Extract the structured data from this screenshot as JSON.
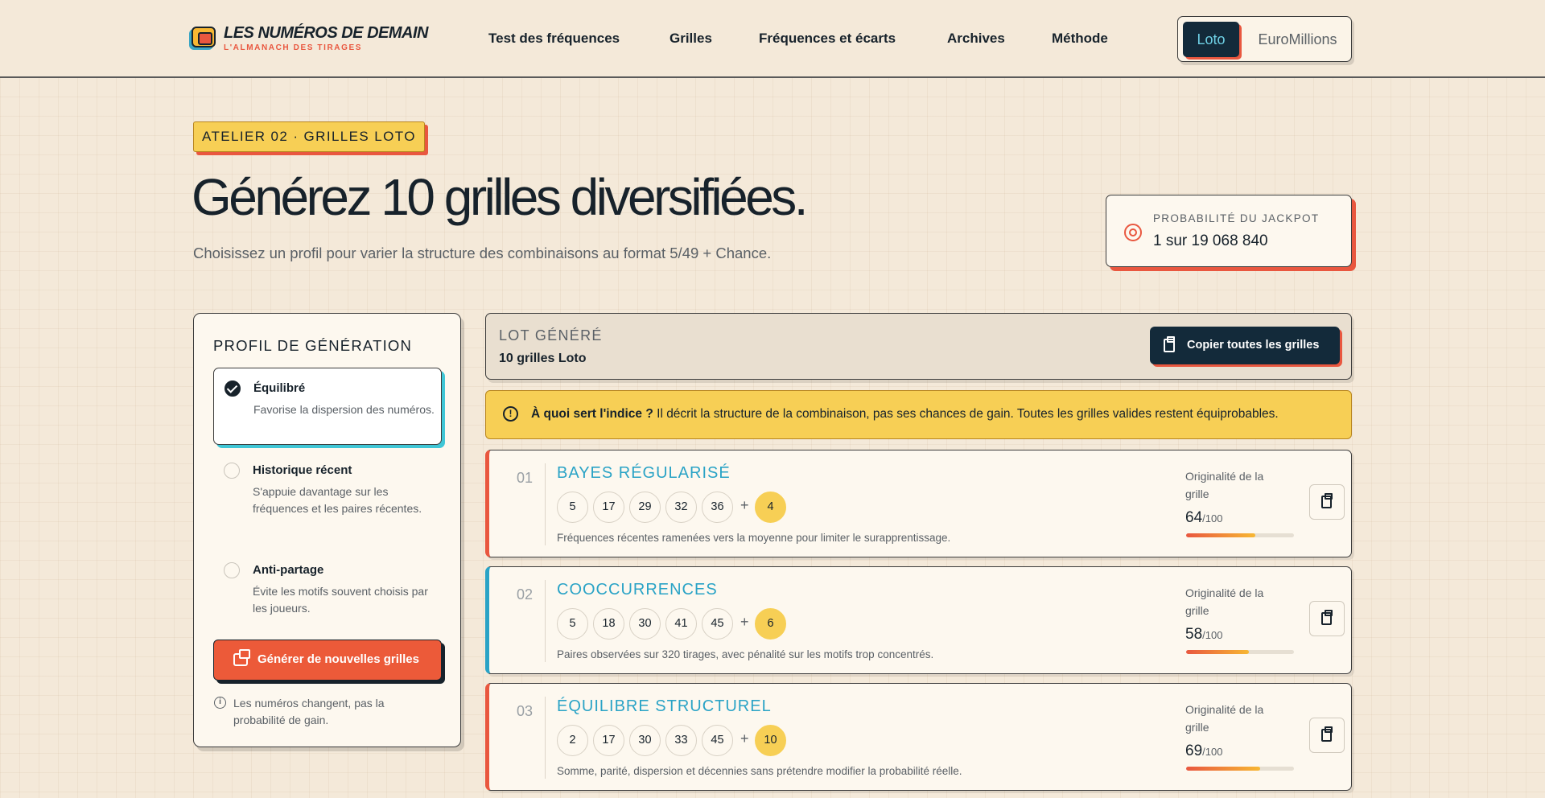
{
  "header": {
    "logo_title": "LES NUMÉROS DE DEMAIN",
    "logo_subtitle": "L'ALMANACH DES TIRAGES",
    "nav": [
      "Test des fréquences",
      "Grilles",
      "Fréquences et écarts",
      "Archives",
      "Méthode"
    ],
    "game_switch": {
      "active": "Loto",
      "inactive": "EuroMillions"
    }
  },
  "hero": {
    "badge": "ATELIER 02 · GRILLES LOTO",
    "title": "Générez 10 grilles diversifiées.",
    "subtitle": "Choisissez un profil pour varier la structure des combinaisons au format 5/49 + Chance.",
    "jackpot_label": "PROBABILITÉ DU JACKPOT",
    "jackpot_value": "1 sur 19 068 840"
  },
  "sidebar": {
    "title": "PROFIL DE GÉNÉRATION",
    "profiles": [
      {
        "name": "Équilibré",
        "desc": "Favorise la dispersion des numéros.",
        "selected": true
      },
      {
        "name": "Historique récent",
        "desc": "S'appuie davantage sur les fréquences et les paires récentes.",
        "selected": false
      },
      {
        "name": "Anti-partage",
        "desc": "Évite les motifs souvent choisis par les joueurs.",
        "selected": false
      }
    ],
    "generate_label": "Générer de nouvelles grilles",
    "note": "Les numéros changent, pas la probabilité de gain."
  },
  "lot": {
    "label": "LOT GÉNÉRÉ",
    "count": "10 grilles Loto",
    "copy_all_label": "Copier toutes les grilles"
  },
  "info": {
    "strong": "À quoi sert l'indice ?",
    "text": " Il décrit la structure de la combinaison, pas ses chances de gain. Toutes les grilles valides restent équiprobables."
  },
  "grids": [
    {
      "num": "01",
      "title": "BAYES RÉGULARISÉ",
      "numbers": [
        "5",
        "17",
        "29",
        "32",
        "36"
      ],
      "plus": "+",
      "chance": "4",
      "desc": "Fréquences récentes ramenées vers la moyenne pour limiter le surapprentissage.",
      "orig_label": "Originalité de la grille",
      "score": "64",
      "score_max": "/100",
      "accent": "#e9573f"
    },
    {
      "num": "02",
      "title": "COOCCURRENCES",
      "numbers": [
        "5",
        "18",
        "30",
        "41",
        "45"
      ],
      "plus": "+",
      "chance": "6",
      "desc": "Paires observées sur 320 tirages, avec pénalité sur les motifs trop concentrés.",
      "orig_label": "Originalité de la grille",
      "score": "58",
      "score_max": "/100",
      "accent": "#2aa3c6"
    },
    {
      "num": "03",
      "title": "ÉQUILIBRE STRUCTUREL",
      "numbers": [
        "2",
        "17",
        "30",
        "33",
        "45"
      ],
      "plus": "+",
      "chance": "10",
      "desc": "Somme, parité, dispersion et décennies sans prétendre modifier la probabilité réelle.",
      "orig_label": "Originalité de la grille",
      "score": "69",
      "score_max": "/100",
      "accent": "#e9573f"
    }
  ],
  "icons": {
    "logo": "logo-icon",
    "jackpot": "target-icon",
    "selected": "check-icon",
    "generate": "dice-icon",
    "note": "info-icon",
    "copy": "clipboard-icon",
    "warning": "alert-icon"
  }
}
